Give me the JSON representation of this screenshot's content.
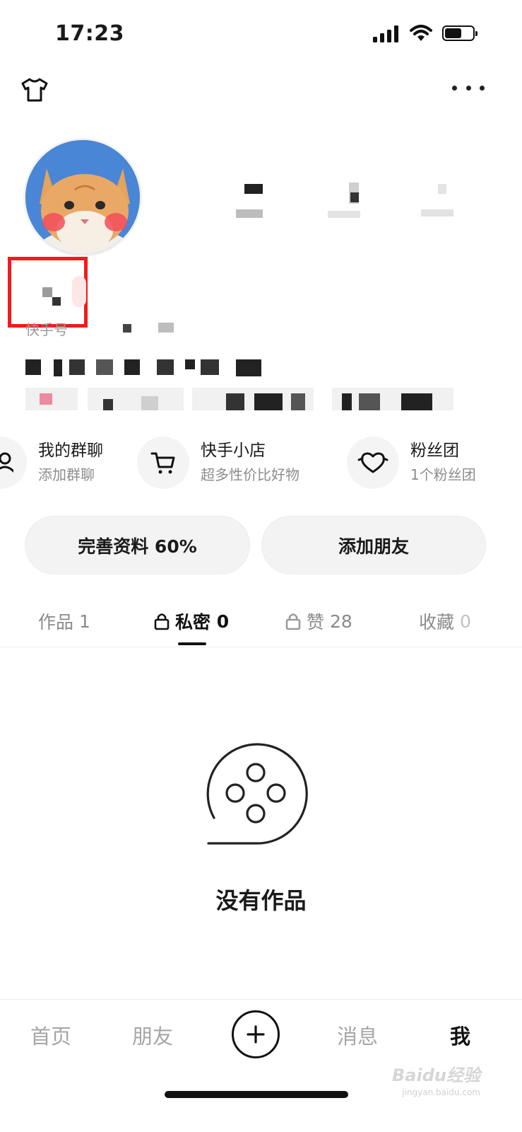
{
  "status_bar": {
    "time": "17:23",
    "icons": [
      "cellular-signal-icon",
      "wifi-icon",
      "battery-icon"
    ]
  },
  "top_bar": {
    "left_icon": "tshirt-icon",
    "right_icon": "more-dots-icon"
  },
  "profile": {
    "avatar": "cat-avatar",
    "id_prefix": "快手号"
  },
  "shortcuts": [
    {
      "title": "我的群聊",
      "subtitle": "添加群聊",
      "icon": "group-chat-icon"
    },
    {
      "title": "快手小店",
      "subtitle": "超多性价比好物",
      "icon": "shopping-cart-icon"
    },
    {
      "title": "粉丝团",
      "subtitle": "1个粉丝团",
      "icon": "heart-badge-icon"
    }
  ],
  "buttons": {
    "complete_profile": "完善资料 60%",
    "add_friend": "添加朋友"
  },
  "tabs": [
    {
      "label": "作品",
      "count": "1",
      "locked": false,
      "active": false
    },
    {
      "label": "私密",
      "count": "0",
      "locked": true,
      "active": true
    },
    {
      "label": "赞",
      "count": "28",
      "locked": true,
      "active": false
    },
    {
      "label": "收藏",
      "count": "0",
      "locked": false,
      "active": false
    }
  ],
  "empty_state": {
    "icon": "film-reel-icon",
    "text": "没有作品"
  },
  "bottom_nav": {
    "home": "首页",
    "friends": "朋友",
    "create_icon": "plus-icon",
    "messages": "消息",
    "me": "我"
  },
  "watermark": {
    "text": "Baidu经验",
    "sub": "jingyan.baidu.com"
  },
  "colors": {
    "highlight_box": "#ee1c1c",
    "active_text": "#111111",
    "inactive_text": "#8a8a8a",
    "avatar_bg": "#4a86d6"
  }
}
